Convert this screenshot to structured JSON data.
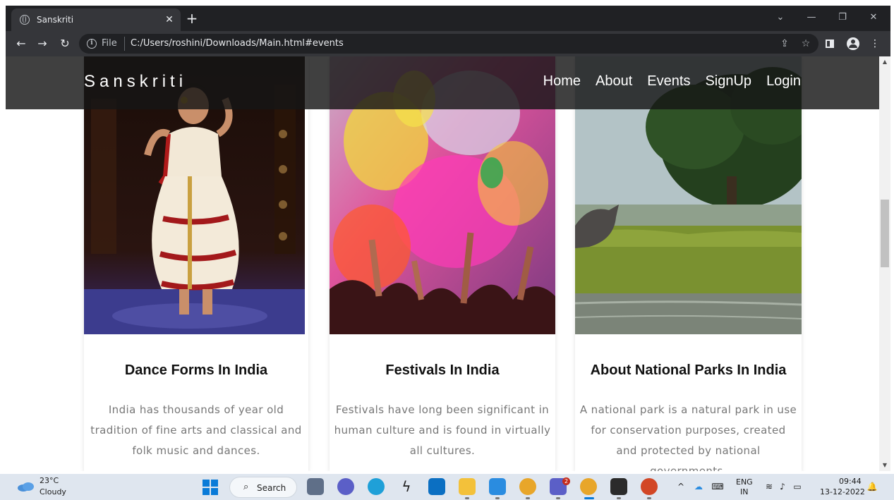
{
  "browser": {
    "tab_title": "Sanskriti",
    "url_scheme": "File",
    "url": "C:/Users/roshini/Downloads/Main.html#events"
  },
  "site": {
    "logo": "Sanskriti",
    "nav": [
      "Home",
      "About",
      "Events",
      "SignUp",
      "Login"
    ]
  },
  "cards": [
    {
      "title": "Dance Forms In India",
      "text": "India has thousands of year old tradition of fine arts and classical and folk music and dances."
    },
    {
      "title": "Festivals In India",
      "text": "Festivals have long been significant in human culture and is found in virtually all cultures."
    },
    {
      "title": "About National Parks In India",
      "text": "A national park is a natural park in use for conservation purposes, created and protected by national governments."
    }
  ],
  "taskbar": {
    "temperature": "23°C",
    "condition": "Cloudy",
    "search_label": "Search",
    "lang_line1": "ENG",
    "lang_line2": "IN",
    "time": "09:44",
    "date": "13-12-2022",
    "teams_badge": "2"
  }
}
